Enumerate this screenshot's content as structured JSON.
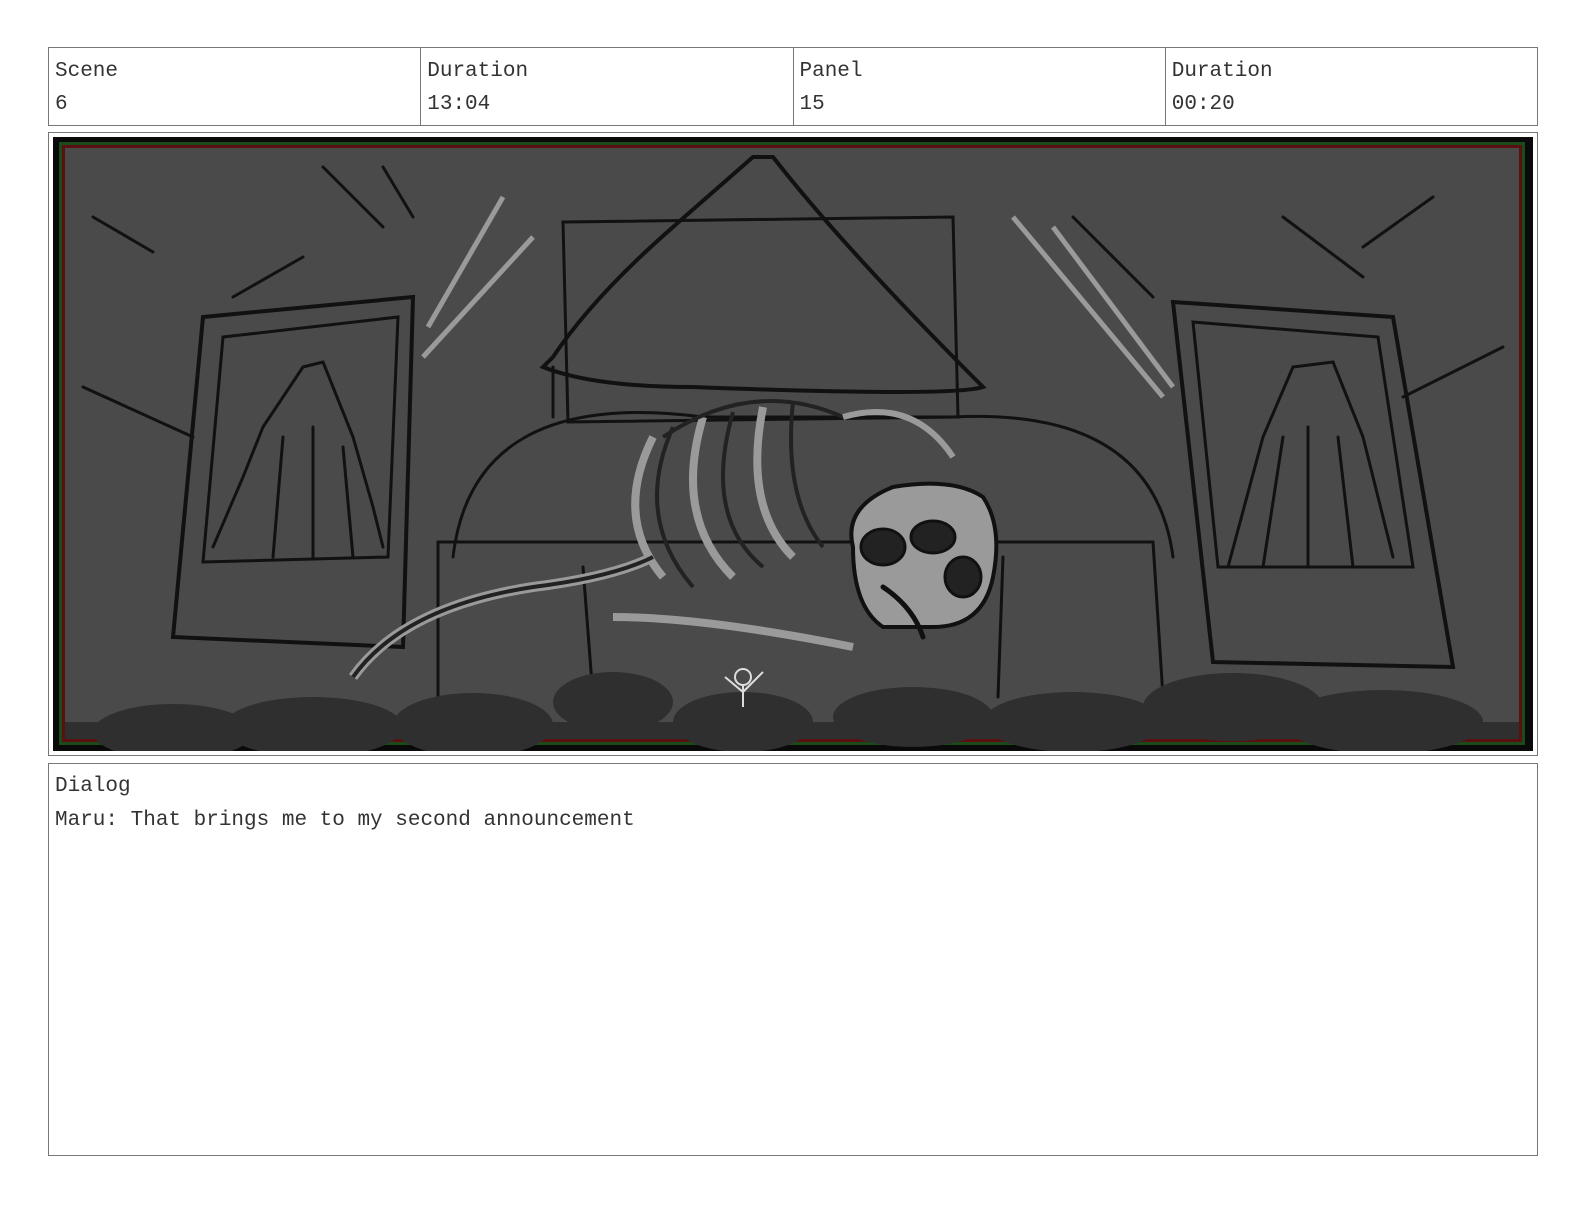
{
  "header": {
    "scene_label": "Scene",
    "scene_value": "6",
    "scene_duration_label": "Duration",
    "scene_duration_value": "13:04",
    "panel_label": "Panel",
    "panel_value": "15",
    "panel_duration_label": "Duration",
    "panel_duration_value": "00:20"
  },
  "dialog": {
    "label": "Dialog",
    "text": "Maru: That brings me to my second announcement"
  },
  "colors": {
    "panel_bg": "#4a4a4a",
    "line": "#111111",
    "bone": "#9a9a9a",
    "crowd": "#2e2e2e"
  }
}
